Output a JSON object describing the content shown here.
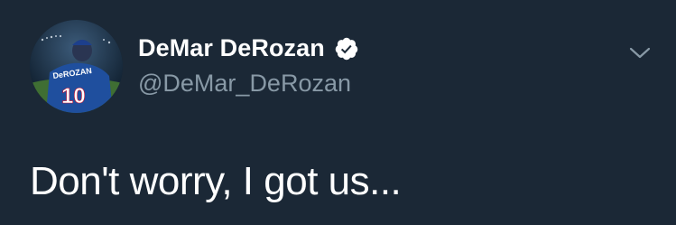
{
  "colors": {
    "background": "#1b2836",
    "name_text": "#ffffff",
    "handle_text": "#8899a6",
    "body_text": "#ffffff",
    "badge": "#ffffff"
  },
  "author": {
    "display_name": "DeMar DeRozan",
    "handle": "@DeMar_DeRozan",
    "verified": true,
    "avatar": {
      "jersey_name": "DeROZAN",
      "jersey_number": "10"
    }
  },
  "icons": {
    "verified": "verified-badge-icon",
    "more": "chevron-down-icon"
  },
  "tweet": {
    "text": "Don't worry, I got us..."
  }
}
